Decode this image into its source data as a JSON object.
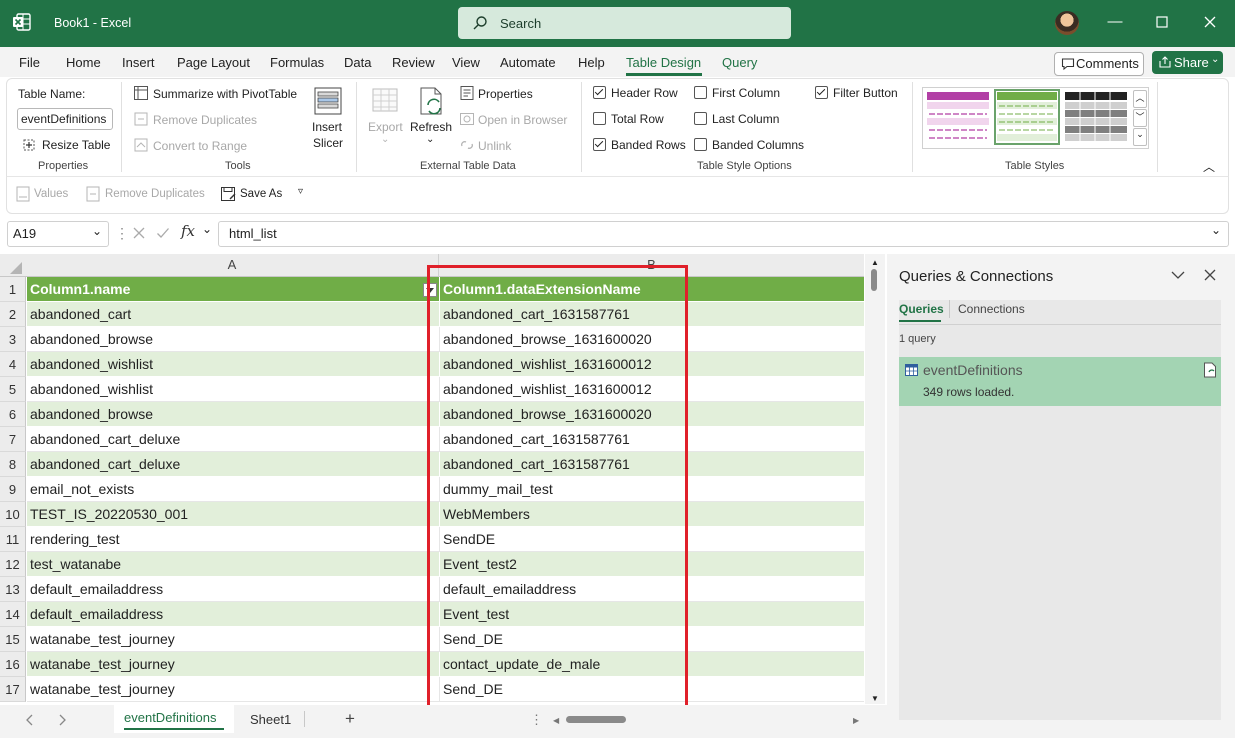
{
  "app": {
    "title": "Book1  -  Excel",
    "search_placeholder": "Search",
    "window_controls": [
      "minimize-icon",
      "maximize-icon",
      "close-icon"
    ]
  },
  "menu": {
    "tabs": [
      "File",
      "Home",
      "Insert",
      "Page Layout",
      "Formulas",
      "Data",
      "Review",
      "View",
      "Automate",
      "Help",
      "Table Design",
      "Query"
    ],
    "active": "Table Design",
    "comments_label": "Comments",
    "share_label": "Share"
  },
  "ribbon": {
    "properties": {
      "table_name_label": "Table Name:",
      "table_name_value": "eventDefinitions",
      "resize_table": "Resize Table",
      "group_label": "Properties"
    },
    "tools": {
      "summarize": "Summarize with PivotTable",
      "remove_duplicates": "Remove Duplicates",
      "convert_to_range": "Convert to Range",
      "insert_slicer_1": "Insert",
      "insert_slicer_2": "Slicer",
      "group_label": "Tools"
    },
    "external": {
      "export": "Export",
      "refresh": "Refresh",
      "properties": "Properties",
      "open_in_browser": "Open in Browser",
      "unlink": "Unlink",
      "group_label": "External Table Data"
    },
    "style_options": {
      "header_row": "Header Row",
      "total_row": "Total Row",
      "banded_rows": "Banded Rows",
      "first_column": "First Column",
      "last_column": "Last Column",
      "banded_columns": "Banded Columns",
      "filter_button": "Filter Button",
      "checked": {
        "header_row": true,
        "total_row": false,
        "banded_rows": true,
        "first_column": false,
        "last_column": false,
        "banded_columns": false,
        "filter_button": true
      },
      "group_label": "Table Style Options"
    },
    "table_styles": {
      "group_label": "Table Styles",
      "swatch_colors": [
        "#b23fa5",
        "#70ad47",
        "#222222"
      ]
    },
    "quick_access": {
      "values": "Values",
      "remove_duplicates": "Remove Duplicates",
      "save_as": "Save As"
    }
  },
  "formula_bar": {
    "name_box": "A19",
    "formula": "html_list"
  },
  "sheet": {
    "columns": [
      "A",
      "B"
    ],
    "header": [
      "Column1.name",
      "Column1.dataExtensionName"
    ],
    "row_numbers": [
      "1",
      "2",
      "3",
      "4",
      "5",
      "6",
      "7",
      "8",
      "9",
      "10",
      "11",
      "12",
      "13",
      "14",
      "15",
      "16",
      "17"
    ],
    "rows": [
      [
        "abandoned_cart",
        "abandoned_cart_1631587761"
      ],
      [
        "abandoned_browse",
        "abandoned_browse_1631600020"
      ],
      [
        "abandoned_wishlist",
        "abandoned_wishlist_1631600012"
      ],
      [
        "abandoned_wishlist",
        "abandoned_wishlist_1631600012"
      ],
      [
        "abandoned_browse",
        "abandoned_browse_1631600020"
      ],
      [
        "abandoned_cart_deluxe",
        "abandoned_cart_1631587761"
      ],
      [
        "abandoned_cart_deluxe",
        "abandoned_cart_1631587761"
      ],
      [
        "email_not_exists",
        "dummy_mail_test"
      ],
      [
        "TEST_IS_20220530_001",
        "WebMembers"
      ],
      [
        "rendering_test",
        "SendDE"
      ],
      [
        "test_watanabe",
        "Event_test2"
      ],
      [
        "default_emailaddress",
        "default_emailaddress"
      ],
      [
        "default_emailaddress",
        "Event_test"
      ],
      [
        "watanabe_test_journey",
        "Send_DE"
      ],
      [
        "watanabe_test_journey",
        "contact_update_de_male"
      ],
      [
        "watanabe_test_journey",
        "Send_DE"
      ]
    ],
    "colors": {
      "header_green": "#70ad47",
      "band_green": "#e2efda",
      "highlight_red": "#e0202a"
    }
  },
  "queries_pane": {
    "title": "Queries & Connections",
    "tabs": [
      "Queries",
      "Connections"
    ],
    "active_tab": "Queries",
    "count": "1 query",
    "item_name": "eventDefinitions",
    "item_status": "349 rows loaded."
  },
  "sheet_tabs": {
    "tabs": [
      "eventDefinitions",
      "Sheet1"
    ],
    "active": "eventDefinitions"
  }
}
